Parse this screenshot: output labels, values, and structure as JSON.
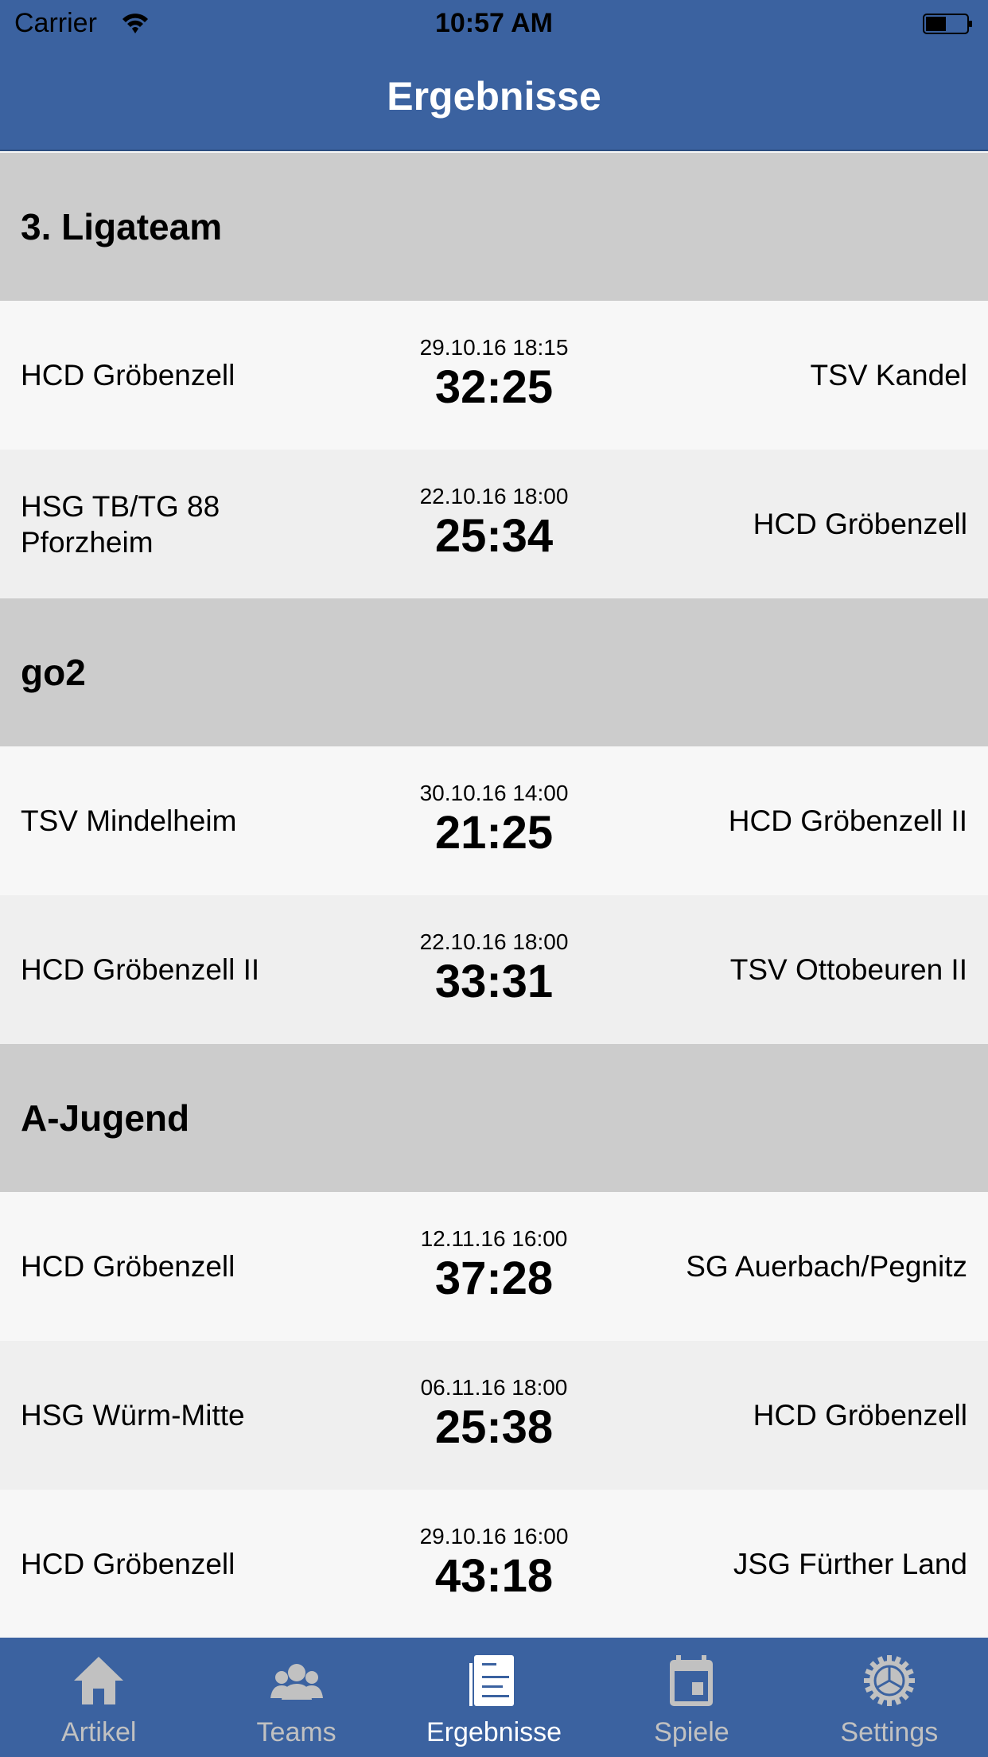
{
  "status_bar": {
    "carrier": "Carrier",
    "time": "10:57 AM",
    "battery_level": 0.5
  },
  "nav": {
    "title": "Ergebnisse"
  },
  "colors": {
    "brand": "#3b62a0",
    "section_bg": "#cccccc",
    "tab_inactive": "#c1c1c1",
    "tab_active": "#ffffff"
  },
  "sections": [
    {
      "title": "3. Ligateam",
      "games": [
        {
          "home": "HCD Gröbenzell",
          "date": "29.10.16 18:15",
          "score": "32:25",
          "away": "TSV Kandel"
        },
        {
          "home": "HSG TB/TG 88 Pforzheim",
          "date": "22.10.16 18:00",
          "score": "25:34",
          "away": "HCD Gröbenzell"
        }
      ]
    },
    {
      "title": "go2",
      "games": [
        {
          "home": "TSV Mindelheim",
          "date": "30.10.16 14:00",
          "score": "21:25",
          "away": "HCD Gröbenzell II"
        },
        {
          "home": "HCD Gröbenzell II",
          "date": "22.10.16 18:00",
          "score": "33:31",
          "away": "TSV Ottobeuren II"
        }
      ]
    },
    {
      "title": "A-Jugend",
      "games": [
        {
          "home": "HCD Gröbenzell",
          "date": "12.11.16 16:00",
          "score": "37:28",
          "away": "SG Auerbach/Pegnitz"
        },
        {
          "home": "HSG Würm-Mitte",
          "date": "06.11.16 18:00",
          "score": "25:38",
          "away": "HCD Gröbenzell"
        },
        {
          "home": "HCD Gröbenzell",
          "date": "29.10.16 16:00",
          "score": "43:18",
          "away": "JSG Fürther Land"
        }
      ]
    }
  ],
  "tabs": [
    {
      "label": "Artikel",
      "icon": "home-icon",
      "active": false
    },
    {
      "label": "Teams",
      "icon": "people-icon",
      "active": false
    },
    {
      "label": "Ergebnisse",
      "icon": "document-icon",
      "active": true
    },
    {
      "label": "Spiele",
      "icon": "calendar-icon",
      "active": false
    },
    {
      "label": "Settings",
      "icon": "gear-icon",
      "active": false
    }
  ]
}
